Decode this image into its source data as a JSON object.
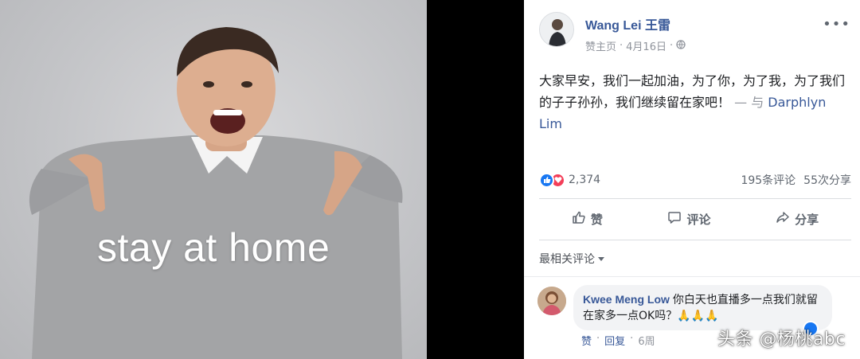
{
  "photo": {
    "caption": "stay at home"
  },
  "post": {
    "author_name": "Wang Lei 王雷",
    "page_label": "赞主页",
    "date": "4月16日",
    "more_icon": "ellipsis-icon",
    "privacy_icon": "globe-icon",
    "text_line": "大家早安，我们一起加油，为了你，为了我，为了我们的子子孙孙，我们继续留在家吧！",
    "with_dash": "— 与",
    "tagged_person": "Darphlyn Lim",
    "reaction_count": "2,374",
    "comment_count": "195条评论",
    "share_count": "55次分享",
    "colors": {
      "link": "#385898",
      "like": "#1877f2",
      "love": "#f33e58"
    }
  },
  "actions": {
    "like": "赞",
    "comment": "评论",
    "share": "分享"
  },
  "comments": {
    "sort_label": "最相关评论",
    "items": [
      {
        "author": "Kwee Meng Low",
        "text": "你白天也直播多一点我们就留在家多一点OK吗？🙏🙏🙏",
        "like_label": "赞",
        "reply_label": "回复",
        "time": "6周"
      }
    ]
  },
  "watermark": "头条 @杨桃abc"
}
